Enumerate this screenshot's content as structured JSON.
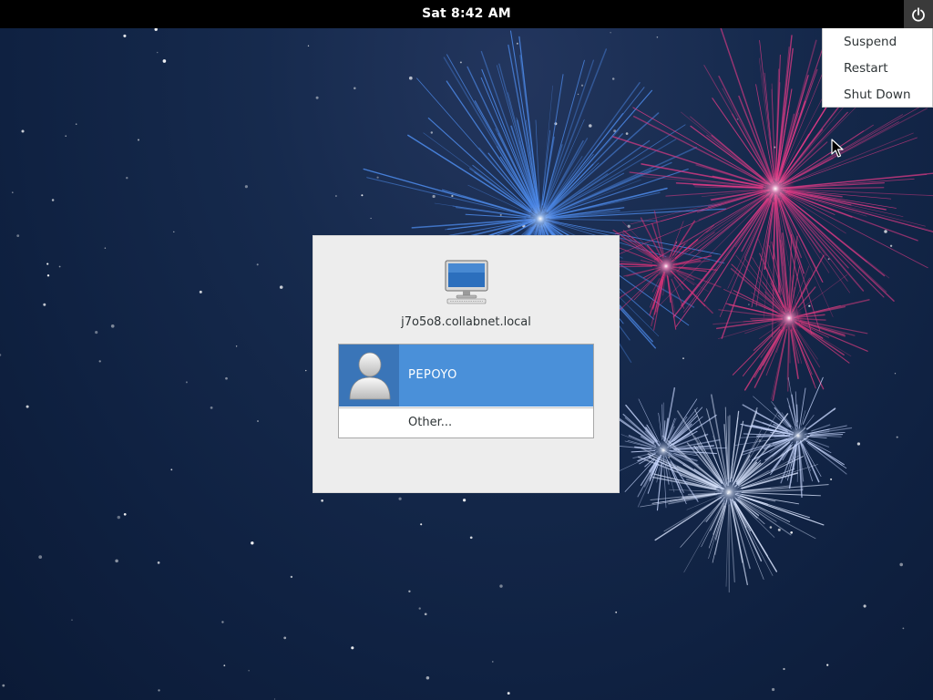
{
  "top_bar": {
    "clock": "Sat  8:42 AM",
    "power_icon": "power-icon"
  },
  "power_menu": {
    "items": [
      {
        "label": "Suspend"
      },
      {
        "label": "Restart"
      },
      {
        "label": "Shut Down"
      }
    ]
  },
  "login": {
    "hostname": "j7o5o8.collabnet.local",
    "computer_icon": "computer-icon",
    "users": [
      {
        "name": "PEPOYO",
        "avatar_icon": "user-avatar-icon",
        "selected": true
      }
    ],
    "other_label": "Other..."
  },
  "colors": {
    "top_bar": "#000000",
    "selection": "#4a90d9",
    "dialog": "#ededed",
    "background": "#122447"
  }
}
